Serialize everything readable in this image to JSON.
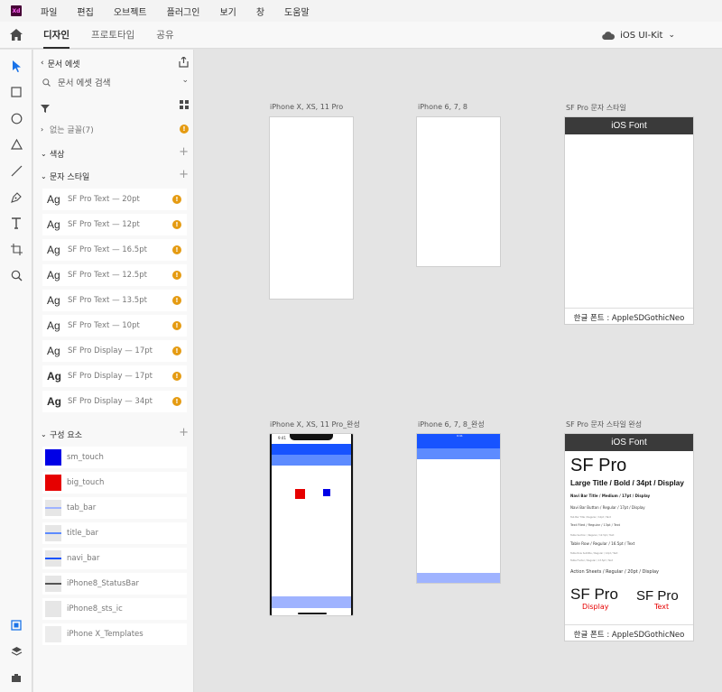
{
  "menubar": {
    "logo": "Xd",
    "items": [
      "파일",
      "편집",
      "오브젝트",
      "플러그인",
      "보기",
      "창",
      "도움말"
    ]
  },
  "modebar": {
    "tabs": [
      "디자인",
      "프로토타입",
      "공유"
    ],
    "active_tab": "디자인",
    "document": "iOS UI-Kit"
  },
  "toolbar": {
    "tools": [
      "select-tool",
      "rectangle-tool",
      "ellipse-tool",
      "polygon-tool",
      "line-tool",
      "pen-tool",
      "text-tool",
      "artboard-tool",
      "zoom-tool"
    ],
    "bottom_tools": [
      "assets-panel",
      "layers-panel",
      "plugins-panel"
    ]
  },
  "assets": {
    "back_label": "문서 에셋",
    "search_placeholder": "문서 에셋 검색",
    "missing_fonts": "없는 글꼴(7)",
    "colors_label": "색상",
    "char_styles_label": "문자 스타일",
    "components_label": "구성 요소",
    "char_styles": [
      {
        "name": "SF Pro Text — 20pt",
        "bold": false
      },
      {
        "name": "SF Pro Text — 12pt",
        "bold": false
      },
      {
        "name": "SF Pro Text — 16.5pt",
        "bold": false
      },
      {
        "name": "SF Pro Text — 12.5pt",
        "bold": false
      },
      {
        "name": "SF Pro Text — 13.5pt",
        "bold": false
      },
      {
        "name": "SF Pro Text — 10pt",
        "bold": false
      },
      {
        "name": "SF Pro Display — 17pt",
        "bold": false
      },
      {
        "name": "SF Pro Display — 17pt",
        "bold": true
      },
      {
        "name": "SF Pro Display — 34pt",
        "bold": true
      }
    ],
    "ag_glyph": "Ag",
    "components": [
      {
        "name": "sm_touch",
        "thumb": "blue"
      },
      {
        "name": "big_touch",
        "thumb": "red"
      },
      {
        "name": "tab_bar",
        "thumb": "line-light"
      },
      {
        "name": "title_bar",
        "thumb": "line-mid"
      },
      {
        "name": "navi_bar",
        "thumb": "line-dark"
      },
      {
        "name": "iPhone8_StatusBar",
        "thumb": "line-gray"
      },
      {
        "name": "iPhone8_sts_ic",
        "thumb": "plain"
      },
      {
        "name": "iPhone X_Templates",
        "thumb": "plain"
      }
    ]
  },
  "canvas": {
    "artboards": [
      {
        "label": "iPhone X, XS, 11 Pro"
      },
      {
        "label": "iPhone 6, 7, 8"
      },
      {
        "label": "SF Pro 문자 스타일",
        "header": "iOS Font",
        "footer": "한글 폰트 : AppleSDGothicNeo"
      },
      {
        "label": "iPhone X, XS, 11 Pro_완성",
        "status_time": "9:41"
      },
      {
        "label": "iPhone 6, 7, 8_완성",
        "status_time": "9:41"
      },
      {
        "label": "SF Pro 문자 스타일 완성",
        "header": "iOS Font",
        "footer": "한글 폰트 : AppleSDGothicNeo",
        "big_title": "SF Pro",
        "large_title": "Large Title / Bold / 34pt / Display",
        "lines": [
          "Navi Bar Title / Medium / 17pt / Display",
          "Navi Bar Button / Regular / 17pt / Display",
          "Tab Bar Title / Regular / 10pt / Text",
          "Text Filed / Regular / 13pt / Text",
          "Table Section / Regular / 12.5pt / Text",
          "Table Row / Regular / 16.5pt / Text",
          "Table Row Subtitle / Regular / 12pt / Text",
          "Table Footer / Regular / 13.5pt / Text",
          "Action Sheets / Regular / 20pt / Display"
        ],
        "sample_display": "SF Pro",
        "sample_display_sub": "Display",
        "sample_text": "SF Pro",
        "sample_text_sub": "Text"
      }
    ]
  },
  "colors": {
    "accent_blue": "#1a73e8",
    "warning": "#e59b12",
    "phone_blue": "#1753ff",
    "phone_blue_light": "#5d8bff",
    "phone_bar_light": "#9fb3ff",
    "touch_red": "#e60000",
    "touch_blue": "#0000e6"
  }
}
